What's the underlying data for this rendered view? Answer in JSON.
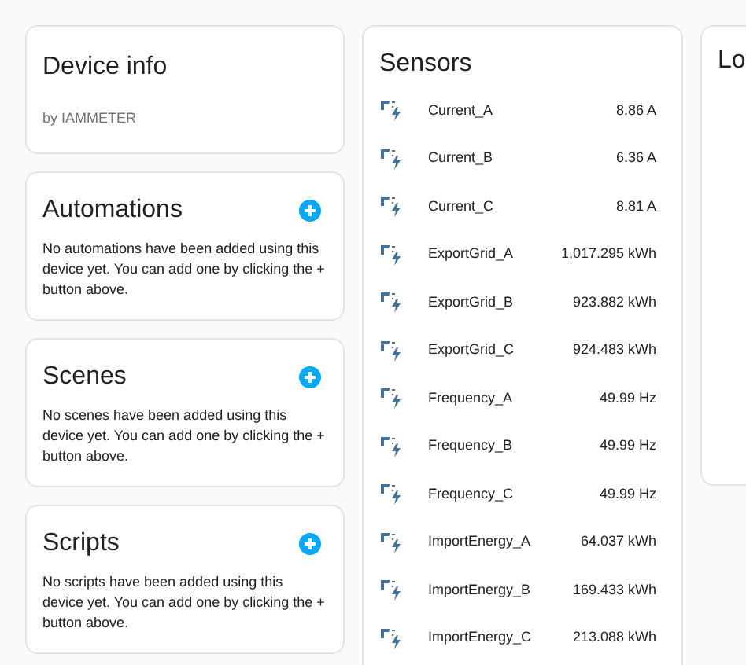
{
  "device_info": {
    "title": "Device info",
    "manufacturer": "by IAMMETER"
  },
  "sections": [
    {
      "title": "Automations",
      "message": "No automations have been added using this device yet. You can add one by clicking the + button above."
    },
    {
      "title": "Scenes",
      "message": "No scenes have been added using this device yet. You can add one by clicking the + button above."
    },
    {
      "title": "Scripts",
      "message": "No scripts have been added using this device yet. You can add one by clicking the + button above."
    }
  ],
  "sensors": {
    "title": "Sensors",
    "items": [
      {
        "name": "Current_A",
        "value": "8.86 A"
      },
      {
        "name": "Current_B",
        "value": "6.36 A"
      },
      {
        "name": "Current_C",
        "value": "8.81 A"
      },
      {
        "name": "ExportGrid_A",
        "value": "1,017.295 kWh"
      },
      {
        "name": "ExportGrid_B",
        "value": "923.882 kWh"
      },
      {
        "name": "ExportGrid_C",
        "value": "924.483 kWh"
      },
      {
        "name": "Frequency_A",
        "value": "49.99 Hz"
      },
      {
        "name": "Frequency_B",
        "value": "49.99 Hz"
      },
      {
        "name": "Frequency_C",
        "value": "49.99 Hz"
      },
      {
        "name": "ImportEnergy_A",
        "value": "64.037 kWh"
      },
      {
        "name": "ImportEnergy_B",
        "value": "169.433 kWh"
      },
      {
        "name": "ImportEnergy_C",
        "value": "213.088 kWh"
      }
    ]
  },
  "logbook": {
    "title": "Lo"
  }
}
